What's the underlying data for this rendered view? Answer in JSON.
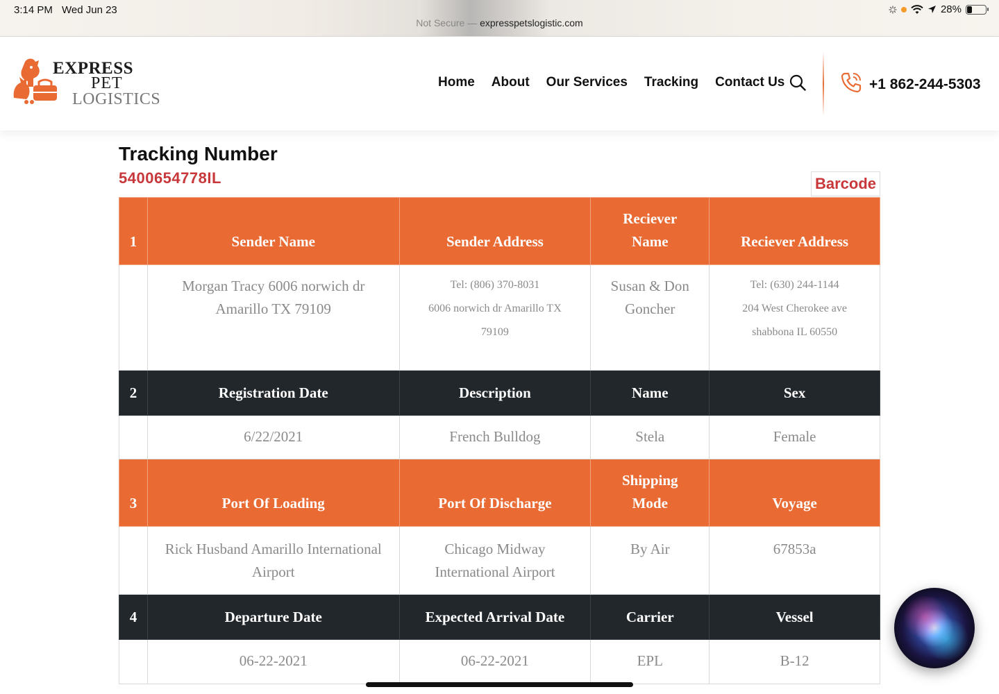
{
  "status_bar": {
    "time": "3:14 PM",
    "date": "Wed Jun 23",
    "url_prefix": "Not Secure —",
    "url": "expresspetslogistic.com",
    "battery": "28%"
  },
  "brand": {
    "line1": "EXPRESS",
    "line2": "PET",
    "line3": "LOGISTICS",
    "accent_color": "#e96b33",
    "dark_color": "#22272b",
    "red_color": "#c8373a"
  },
  "nav": {
    "items": [
      "Home",
      "About",
      "Our Services",
      "Tracking",
      "Contact Us"
    ],
    "phone": "+1 862-244-5303"
  },
  "tracking": {
    "title": "Tracking Number",
    "number": "5400654778IL",
    "barcode_label": "Barcode"
  },
  "table": {
    "sections": [
      {
        "num": "1",
        "headers": [
          "Sender Name",
          "Sender Address",
          "Reciever\nName",
          "Reciever Address"
        ],
        "values": [
          "Morgan Tracy 6006 norwich dr Amarillo TX 79109",
          "Tel: (806) 370-8031\n6006 norwich dr Amarillo TX 79109",
          "Susan & Don Goncher",
          "Tel: (630) 244-1144\n204 West Cherokee ave shabbona IL 60550"
        ]
      },
      {
        "num": "2",
        "headers": [
          "Registration Date",
          "Description",
          "Name",
          "Sex"
        ],
        "values": [
          "6/22/2021",
          "French Bulldog",
          "Stela",
          "Female"
        ]
      },
      {
        "num": "3",
        "headers": [
          "Port Of Loading",
          "Port Of Discharge",
          "Shipping\nMode",
          "Voyage"
        ],
        "values": [
          "Rick Husband Amarillo International Airport",
          "Chicago Midway International Airport",
          "By Air",
          "67853a"
        ]
      },
      {
        "num": "4",
        "headers": [
          "Departure Date",
          "Expected Arrival Date",
          "Carrier",
          "Vessel"
        ],
        "values": [
          "06-22-2021",
          "06-22-2021",
          "EPL",
          "B-12"
        ]
      }
    ],
    "s1": {
      "num": "1",
      "h1": "Sender Name",
      "h2": "Sender Address",
      "h3a": "Reciever",
      "h3b": "Name",
      "h4": "Reciever Address",
      "v1": "Morgan Tracy 6006 norwich dr Amarillo TX 79109",
      "v2a": "Tel: (806) 370-8031",
      "v2b": "6006 norwich dr Amarillo TX 79109",
      "v3": "Susan & Don Goncher",
      "v4a": "Tel: (630) 244-1144",
      "v4b": "204 West Cherokee ave shabbona IL 60550"
    },
    "s2": {
      "num": "2",
      "h1": "Registration Date",
      "h2": "Description",
      "h3": "Name",
      "h4": "Sex",
      "v1": "6/22/2021",
      "v2": "French Bulldog",
      "v3": "Stela",
      "v4": "Female"
    },
    "s3": {
      "num": "3",
      "h1": "Port Of Loading",
      "h2": "Port Of Discharge",
      "h3a": "Shipping",
      "h3b": "Mode",
      "h4": "Voyage",
      "v1": "Rick Husband Amarillo International Airport",
      "v2": "Chicago Midway International Airport",
      "v3": "By Air",
      "v4": "67853a"
    },
    "s4": {
      "num": "4",
      "h1": "Departure Date",
      "h2": "Expected Arrival Date",
      "h3": "Carrier",
      "h4": "Vessel",
      "v1": "06-22-2021",
      "v2": "06-22-2021",
      "v3": "EPL",
      "v4": "B-12"
    }
  },
  "icons": {
    "search": "search-icon",
    "phone": "phone-icon",
    "wifi": "wifi-icon",
    "location": "location-arrow-icon",
    "battery": "battery-icon",
    "siri": "siri-icon"
  }
}
